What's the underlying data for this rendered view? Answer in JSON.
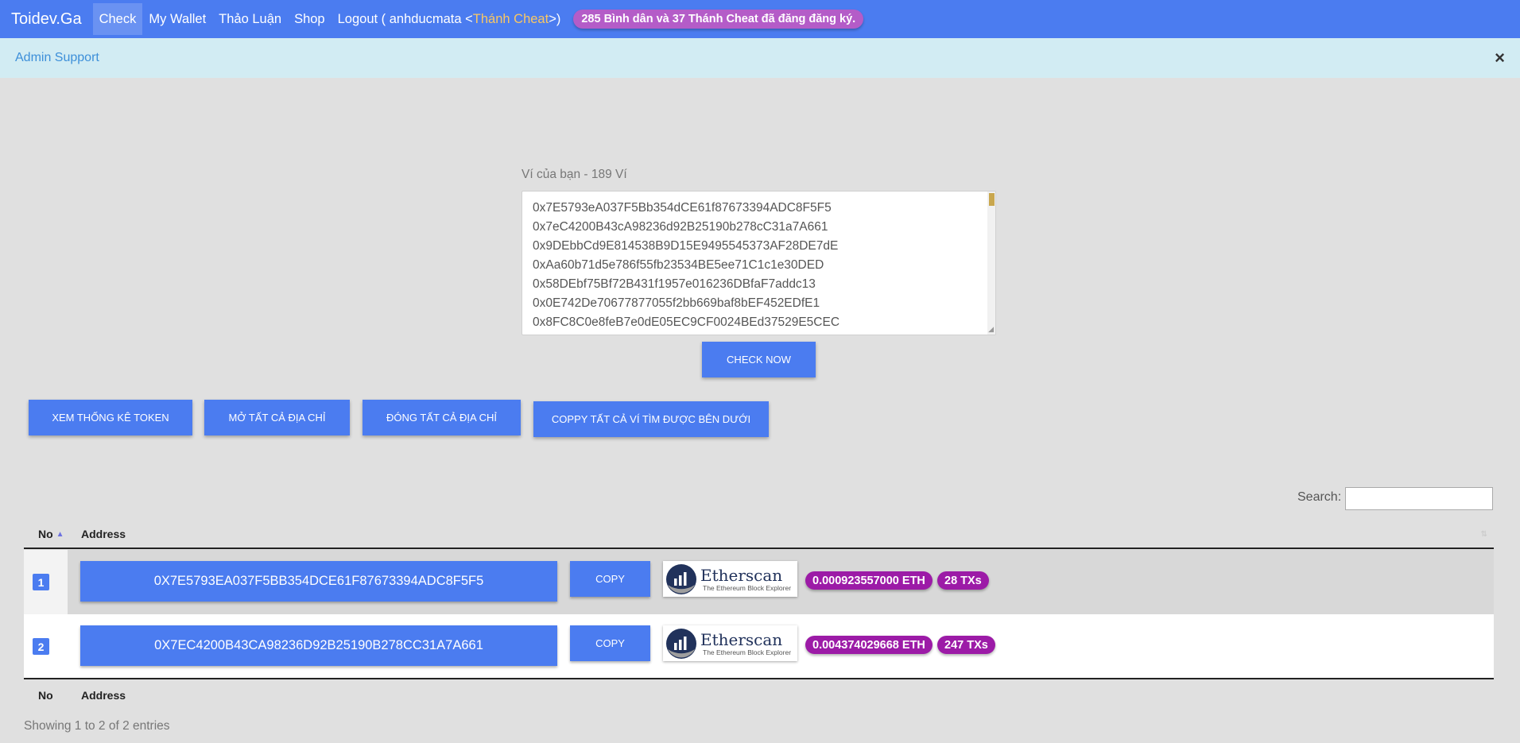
{
  "navbar": {
    "brand": "Toidev.Ga",
    "items": [
      {
        "label": "Check",
        "active": true
      },
      {
        "label": "My Wallet",
        "active": false
      },
      {
        "label": "Thảo Luận",
        "active": false
      },
      {
        "label": "Shop",
        "active": false
      }
    ],
    "logout_prefix": "Logout ( anhducmata <",
    "logout_role": "Thánh Cheat",
    "logout_suffix": ">)",
    "registration_badge": "285 Bình dân và 37 Thánh Cheat đã đăng đăng ký."
  },
  "alert": {
    "text": "Admin Support",
    "close": "×"
  },
  "wallet_form": {
    "label": "Ví của bạn - 189 Ví",
    "addresses": [
      "0x7E5793eA037F5Bb354dCE61f87673394ADC8F5F5",
      "0x7eC4200B43cA98236d92B25190b278cC31a7A661",
      "0x9DEbbCd9E814538B9D15E9495545373AF28DE7dE",
      "0xAa60b71d5e786f55fb23534BE5ee71C1c1e30DED",
      "0x58DEbf75Bf72B431f1957e016236DBfaF7addc13",
      "0x0E742De70677877055f2bb669baf8bEF452EDfE1",
      "0x8FC8C0e8feB7e0dE05EC9CF0024BEd37529E5CEC"
    ],
    "check_button": "Check Now"
  },
  "actions": {
    "stats": "Xem thống kê token",
    "open_all": "Mở tất cả địa chỉ",
    "close_all": "Đóng tất cả địa chỉ",
    "copy_all": "Coppy tất cả ví tìm được bên dưới"
  },
  "search": {
    "label": "Search:",
    "value": ""
  },
  "table": {
    "headers": {
      "no": "No",
      "address": "Address"
    },
    "rows": [
      {
        "no": "1",
        "address": "0X7E5793EA037F5BB354DCE61F87673394ADC8F5F5",
        "copy": "Copy",
        "eth": "0.000923557000 ETH",
        "txs": "28 TXs"
      },
      {
        "no": "2",
        "address": "0X7EC4200B43CA98236D92B25190B278CC31A7A661",
        "copy": "Copy",
        "eth": "0.004374029668 ETH",
        "txs": "247 TXs"
      }
    ],
    "etherscan_name": "Etherscan",
    "etherscan_tag": "The Ethereum Block Explorer",
    "showing": "Showing 1 to 2 of 2 entries"
  },
  "colors": {
    "primary": "#4b7cf0",
    "badge_purple": "#9c1ba7",
    "role_gold": "#f9c763",
    "alert_bg": "#d2ecf3"
  }
}
